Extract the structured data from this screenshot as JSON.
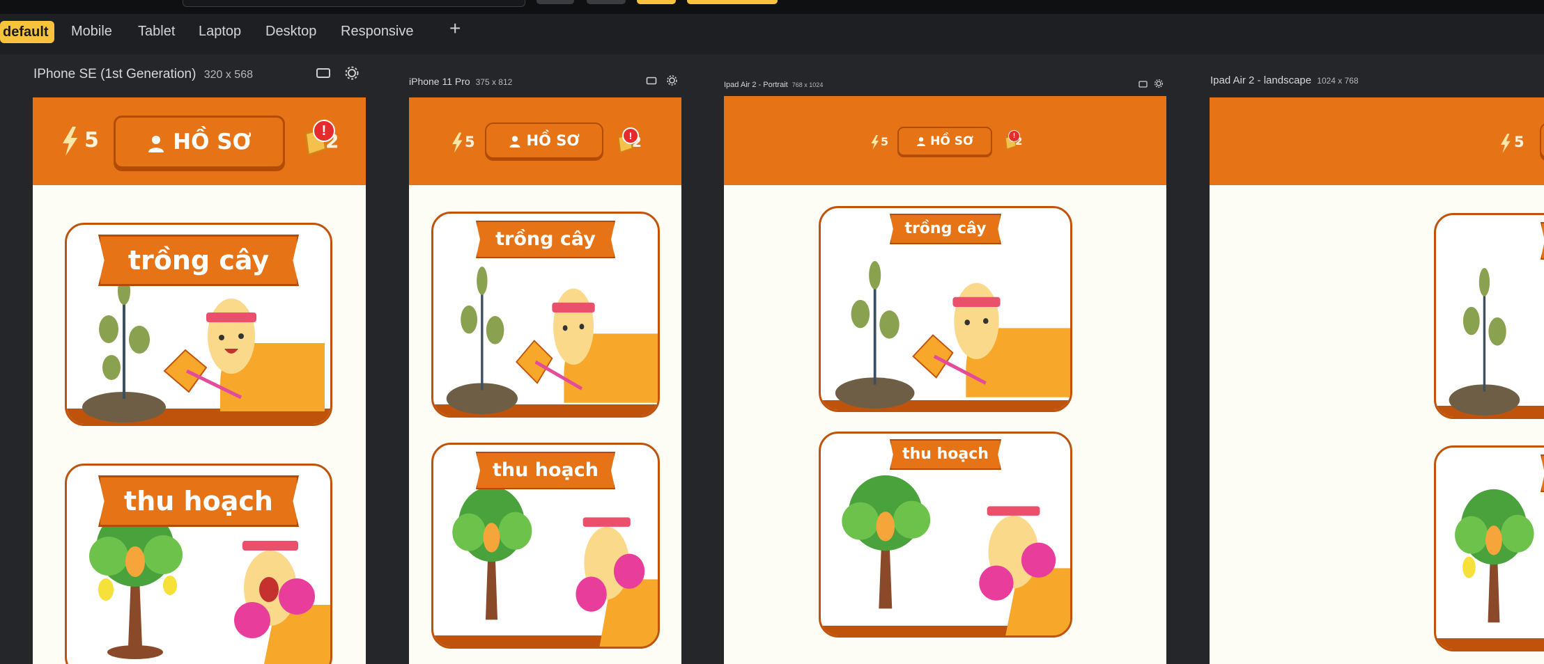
{
  "tabs": [
    {
      "label": "default",
      "active": true
    },
    {
      "label": "Mobile"
    },
    {
      "label": "Tablet"
    },
    {
      "label": "Laptop"
    },
    {
      "label": "Desktop"
    },
    {
      "label": "Responsive"
    }
  ],
  "add_tab_icon": "plus-icon",
  "devices": [
    {
      "name": "IPhone SE (1st Generation)",
      "size": "320 x 568"
    },
    {
      "name": "iPhone 11 Pro",
      "size": "375 x 812"
    },
    {
      "name": "Ipad Air 2 - Portrait",
      "size": "768 x 1024"
    },
    {
      "name": "Ipad Air 2 - landscape",
      "size": "1024 x 768"
    }
  ],
  "app": {
    "energy": "5",
    "profile_label": "HỒ SƠ",
    "coins": "2",
    "alert": "!",
    "cards": [
      "trồng cây",
      "thu hoạch"
    ]
  },
  "colors": {
    "accent": "#f6c43a",
    "app_orange": "#e67417",
    "card_border": "#c0530b"
  }
}
